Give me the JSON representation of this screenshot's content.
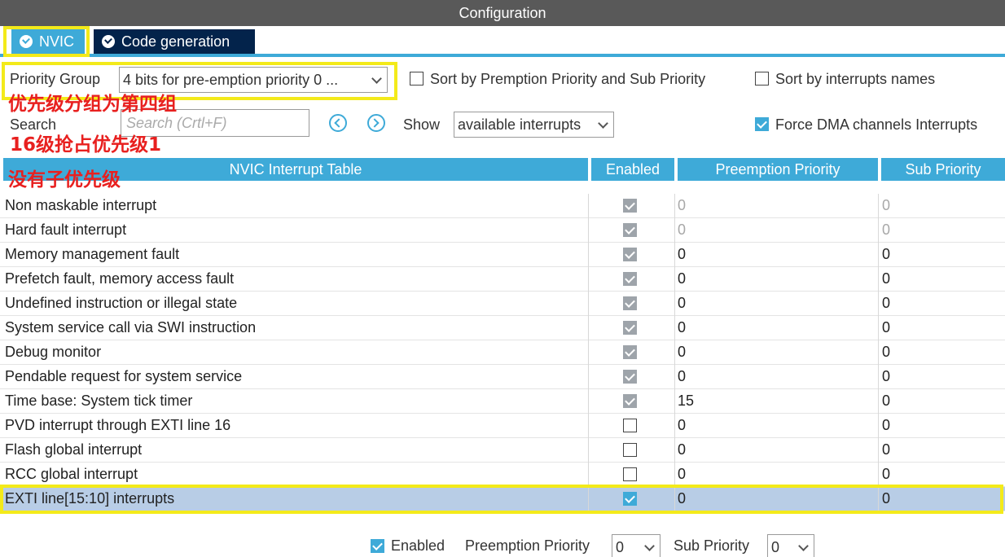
{
  "window": {
    "title": "Configuration"
  },
  "tabs": [
    {
      "label": "NVIC"
    },
    {
      "label": "Code generation"
    }
  ],
  "controls": {
    "priority_group_label": "Priority Group",
    "priority_group_value": "4 bits for pre-emption priority 0 ...",
    "sort_by_priority_label": "Sort by Premption Priority and Sub Priority",
    "sort_by_names_label": "Sort by interrupts names",
    "search_label": "Search",
    "search_placeholder": "Search (Crtl+F)",
    "show_label": "Show",
    "show_value": "available interrupts",
    "force_dma_label": "Force DMA channels Interrupts"
  },
  "annotations": [
    "优先级分组为第四组",
    "16级抢占优先级1",
    "没有子优先级"
  ],
  "table": {
    "headers": [
      "NVIC Interrupt Table",
      "Enabled",
      "Preemption Priority",
      "Sub Priority"
    ],
    "rows": [
      {
        "name": "Non maskable interrupt",
        "enabled": "locked",
        "preemption": "0",
        "sub": "0",
        "dim": true
      },
      {
        "name": "Hard fault interrupt",
        "enabled": "locked",
        "preemption": "0",
        "sub": "0",
        "dim": true
      },
      {
        "name": "Memory management fault",
        "enabled": "locked",
        "preemption": "0",
        "sub": "0"
      },
      {
        "name": "Prefetch fault, memory access fault",
        "enabled": "locked",
        "preemption": "0",
        "sub": "0"
      },
      {
        "name": "Undefined instruction or illegal state",
        "enabled": "locked",
        "preemption": "0",
        "sub": "0"
      },
      {
        "name": "System service call via SWI instruction",
        "enabled": "locked",
        "preemption": "0",
        "sub": "0"
      },
      {
        "name": "Debug monitor",
        "enabled": "locked",
        "preemption": "0",
        "sub": "0"
      },
      {
        "name": "Pendable request for system service",
        "enabled": "locked",
        "preemption": "0",
        "sub": "0"
      },
      {
        "name": "Time base: System tick timer",
        "enabled": "locked",
        "preemption": "15",
        "sub": "0"
      },
      {
        "name": "PVD interrupt through EXTI line 16",
        "enabled": "off",
        "preemption": "0",
        "sub": "0"
      },
      {
        "name": "Flash global interrupt",
        "enabled": "off",
        "preemption": "0",
        "sub": "0"
      },
      {
        "name": "RCC global interrupt",
        "enabled": "off",
        "preemption": "0",
        "sub": "0"
      },
      {
        "name": "EXTI line[15:10] interrupts",
        "enabled": "on",
        "preemption": "0",
        "sub": "0",
        "selected": true
      }
    ]
  },
  "footer": {
    "enabled_label": "Enabled",
    "preemption_label": "Preemption Priority",
    "preemption_value": "0",
    "sub_label": "Sub Priority",
    "sub_value": "0"
  },
  "colors": {
    "accent": "#3eaad8",
    "titlebar": "#595959",
    "tab_inactive": "#03234b",
    "highlight": "#f3ea1a",
    "annotation": "#e8201f",
    "selected_row": "#b8cde6"
  }
}
